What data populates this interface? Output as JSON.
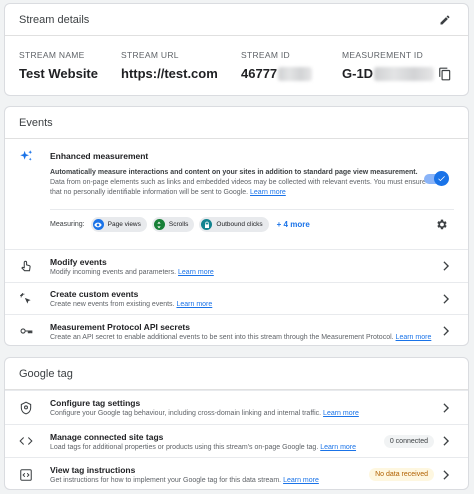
{
  "stream_details": {
    "title": "Stream details",
    "stream_name": {
      "label": "STREAM NAME",
      "value": "Test Website"
    },
    "stream_url": {
      "label": "STREAM URL",
      "value": "https://test.com"
    },
    "stream_id": {
      "label": "STREAM ID",
      "value": "46777"
    },
    "measurement_id": {
      "label": "MEASUREMENT ID",
      "value": "G-1D"
    }
  },
  "events": {
    "title": "Events",
    "enhanced": {
      "title": "Enhanced measurement",
      "desc_bold": "Automatically measure interactions and content on your sites in addition to standard page view measurement.",
      "desc_rest": "Data from on-page elements such as links and embedded videos may be collected with relevant events. You must ensure that no personally identifiable information will be sent to Google.",
      "learn_more": "Learn more",
      "toggle_on": true,
      "measuring_label": "Measuring:",
      "chips": [
        "Page views",
        "Scrolls",
        "Outbound clicks"
      ],
      "more": "+ 4 more"
    },
    "rows": [
      {
        "title": "Modify events",
        "desc": "Modify incoming events and parameters.",
        "link": "Learn more"
      },
      {
        "title": "Create custom events",
        "desc": "Create new events from existing events.",
        "link": "Learn more"
      },
      {
        "title": "Measurement Protocol API secrets",
        "desc": "Create an API secret to enable additional events to be sent into this stream through the Measurement Protocol.",
        "link": "Learn more"
      }
    ]
  },
  "google_tag": {
    "title": "Google tag",
    "rows": [
      {
        "title": "Configure tag settings",
        "desc": "Configure your Google tag behaviour, including cross-domain linking and internal traffic.",
        "link": "Learn more",
        "badge": ""
      },
      {
        "title": "Manage connected site tags",
        "desc": "Load tags for additional properties or products using this stream's on-page Google tag.",
        "link": "Learn more",
        "badge": "0 connected"
      },
      {
        "title": "View tag instructions",
        "desc": "Get instructions for how to implement your Google tag for this data stream.",
        "link": "Learn more",
        "badge": "No data received"
      }
    ]
  },
  "colors": {
    "accent": "#1a73e8",
    "warning_bg": "#fef7e0",
    "warning_text": "#b06000"
  }
}
